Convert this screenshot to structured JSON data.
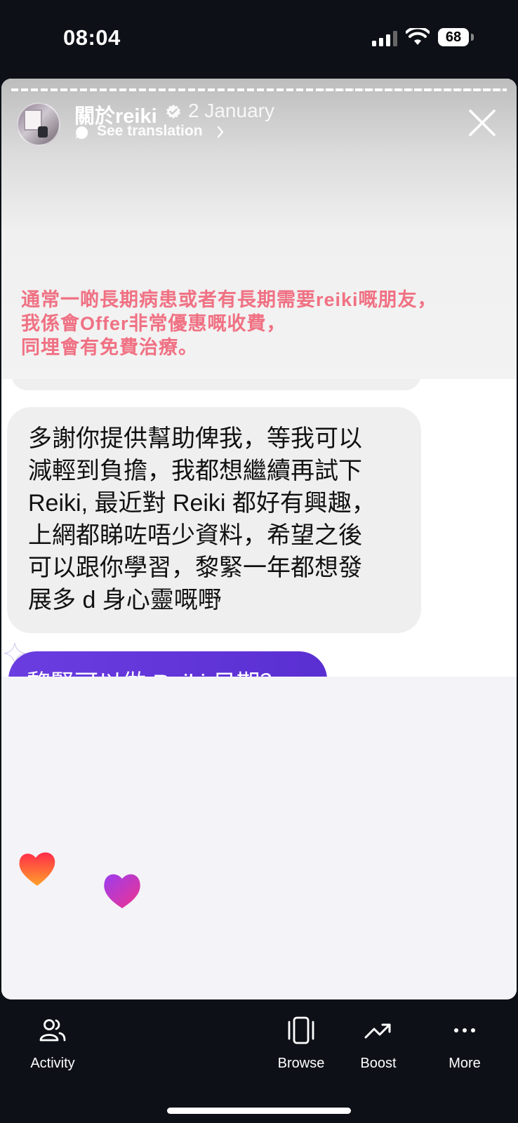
{
  "status_bar": {
    "time": "08:04",
    "battery": "68"
  },
  "story": {
    "account_name": "關於reiki",
    "date": "2 January",
    "translate_label": "See translation",
    "overlay_lines": [
      "通常一啲長期病患或者有長期需要reiki嘅朋友，",
      "我係會Offer非常優惠嘅收費，",
      "同埋會有免費治療。"
    ]
  },
  "chat": {
    "message_lines": [
      "多謝你提供幫助俾我，等我可以",
      "減輕到負擔，我都想繼續再試下",
      "Reiki, 最近對 Reiki 都好有興趣，",
      "上網都睇咗唔少資料，希望之後",
      "可以跟你學習，黎緊一年都想發",
      "展多 d 身心靈嘅嘢"
    ],
    "reply_partial": "黎緊可以做 Reiki 日期？"
  },
  "nav": {
    "activity": "Activity",
    "browse": "Browse",
    "boost": "Boost",
    "more": "More"
  },
  "colors": {
    "overlay_text": "#f07183",
    "reply_bubble": "#5a2fd2",
    "background": "#0d1117"
  }
}
